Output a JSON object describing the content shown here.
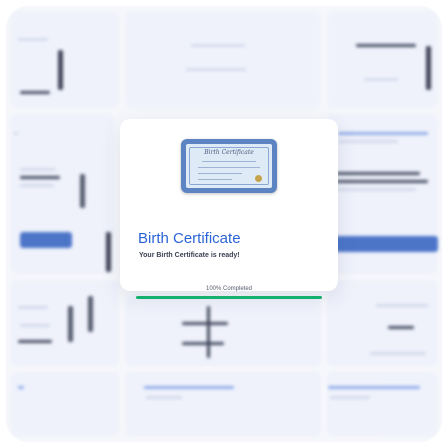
{
  "card": {
    "document_title": "Birth Certificate",
    "title": "Birth Certificate",
    "subtitle": "Your Birth Certificate is ready!",
    "progress": {
      "label": "100%  Completed",
      "value": 1.0
    },
    "document_icon": "certificate-icon"
  },
  "colors": {
    "title": "#2b64d6",
    "progress_fill": "#17b16f",
    "document_frame": "#5d84c2"
  }
}
